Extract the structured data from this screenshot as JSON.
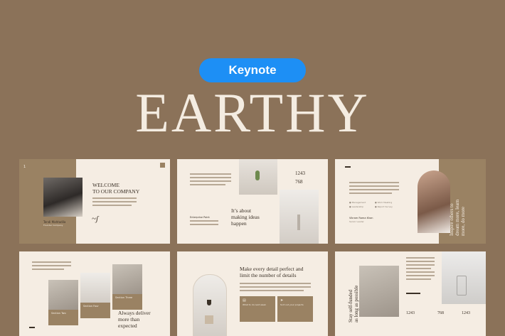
{
  "header": {
    "badge": "Keynote",
    "title": "EARTHY"
  },
  "slides": {
    "s1": {
      "page_number": "1",
      "heading_line1": "WELCOME",
      "heading_line2": "TO OUR COMPANY",
      "name": "Tendi Mahtadila",
      "role": "Founder Company"
    },
    "s2": {
      "stat1": "1243",
      "stat2": "768",
      "heading_line1": "It’s about",
      "heading_line2": "making ideas",
      "heading_line3": "happen",
      "label": "Enterprise Point"
    },
    "s3": {
      "vertical_line1": "Inspire others to",
      "vertical_line2": "dream more, learn",
      "vertical_line3": "more, do more",
      "items": [
        "Management",
        "Work Meeting",
        "Leadership",
        "Report Survey"
      ],
      "name": "Vikram Rama Khan",
      "role": "Senior Leader"
    },
    "s4": {
      "heading_line1": "Always deliver",
      "heading_line2": "more than",
      "heading_line3": "expected",
      "card1": "Section Two",
      "card2": "Section Four",
      "card3": "Section Three"
    },
    "s5": {
      "heading_line1": "Make every detail perfect and",
      "heading_line2": "limit the number of details",
      "card1": "What to do next week",
      "card2": "Sort out your projects"
    },
    "s6": {
      "vertical_line1": "Stay self-funded",
      "vertical_line2": "as long as possible",
      "stats": [
        "1243",
        "768",
        "1243"
      ]
    }
  }
}
